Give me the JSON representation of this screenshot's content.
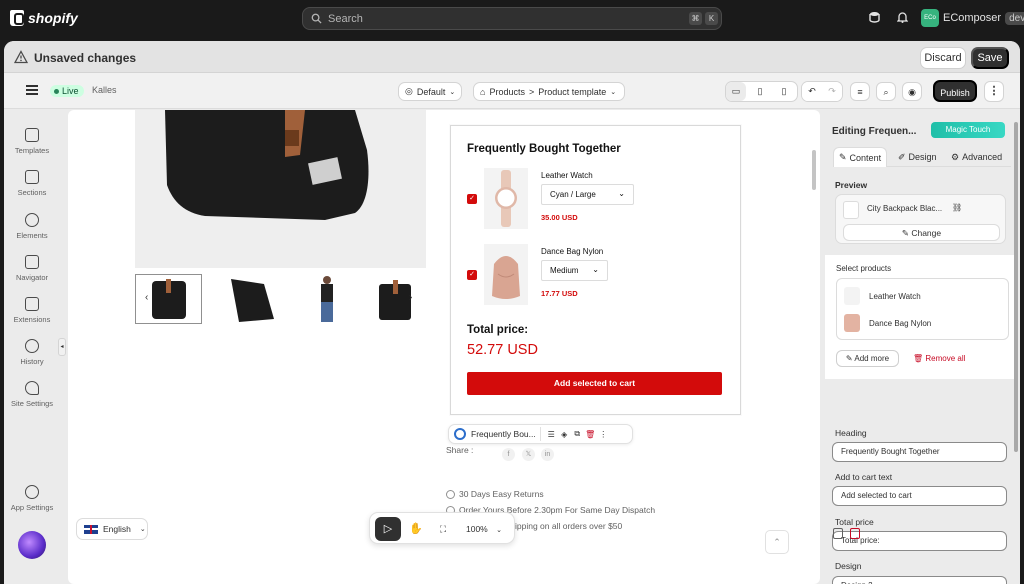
{
  "topbar": {
    "brand": "shopify",
    "search_placeholder": "Search",
    "kbd1": "⌘",
    "kbd2": "K",
    "store_avatar": "ECo",
    "store_name": "EComposer",
    "store_badge": "dev"
  },
  "savebar": {
    "message": "Unsaved changes",
    "discard": "Discard",
    "save": "Save"
  },
  "toolbar": {
    "live": "Live",
    "theme": "Kalles",
    "template_default": "Default",
    "breadcrumb_1": "Products",
    "breadcrumb_sep": ">",
    "breadcrumb_2": "Product template",
    "publish": "Publish"
  },
  "leftnav": {
    "items": [
      {
        "label": "Templates",
        "icon": "templates-icon"
      },
      {
        "label": "Sections",
        "icon": "sections-icon"
      },
      {
        "label": "Elements",
        "icon": "elements-icon"
      },
      {
        "label": "Navigator",
        "icon": "navigator-icon"
      },
      {
        "label": "Extensions",
        "icon": "extensions-icon"
      },
      {
        "label": "History",
        "icon": "history-icon"
      },
      {
        "label": "Site Settings",
        "icon": "site-settings-icon"
      }
    ],
    "app_settings": "App Settings"
  },
  "canvas": {
    "language": "English",
    "share": "Share :",
    "social": [
      "f",
      "𝕏",
      "in"
    ],
    "features": [
      "30 Days Easy Returns",
      "Order Yours Before 2.30pm For Same Day Dispatch",
      "ipping on all orders over $50"
    ],
    "zoom": "100%"
  },
  "section_toolbar": {
    "label": "Frequently Bou..."
  },
  "modal": {
    "title": "Frequently Bought Together",
    "products": [
      {
        "name": "Leather Watch",
        "variant": "Cyan / Large",
        "price": "35.00 USD"
      },
      {
        "name": "Dance Bag Nylon",
        "variant": "Medium",
        "price": "17.77 USD"
      }
    ],
    "total_label": "Total price:",
    "total_value": "52.77 USD",
    "add_button": "Add selected to cart"
  },
  "rpanel": {
    "title": "Editing Frequen...",
    "magic": "Magic Touch",
    "tabs": [
      "Content",
      "Design",
      "Advanced"
    ],
    "preview_label": "Preview",
    "preview_name": "City Backpack Blac...",
    "change": "Change",
    "select_label": "Select products",
    "selected": [
      "Leather Watch",
      "Dance Bag Nylon"
    ],
    "add_more": "Add more",
    "remove_all": "Remove all",
    "heading_label": "Heading",
    "heading_value": "Frequently Bought Together",
    "cart_text_label": "Add to cart text",
    "cart_text_value": "Add selected to cart",
    "total_price_label": "Total price",
    "total_price_value": "Total price:",
    "design_label": "Design",
    "design_value": "Design 2"
  },
  "colors": {
    "accent_red": "#d30b0b",
    "magic": "#2dd4bf",
    "live_green": "#29845a"
  }
}
